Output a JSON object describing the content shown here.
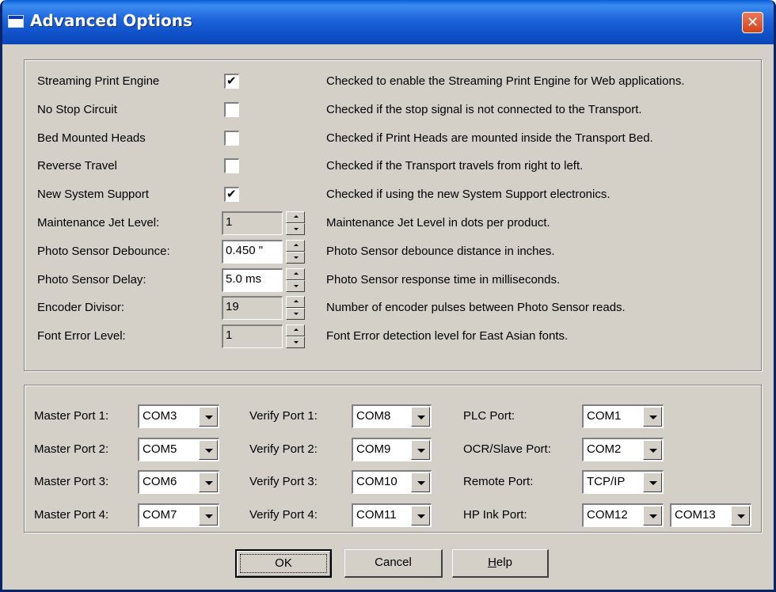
{
  "window": {
    "title": "Advanced Options",
    "close_glyph": "✕"
  },
  "options": [
    {
      "label": "Streaming Print Engine",
      "type": "checkbox",
      "checked": true,
      "description": "Checked to enable the Streaming Print Engine for Web applications."
    },
    {
      "label": "No Stop Circuit",
      "type": "checkbox",
      "checked": false,
      "description": "Checked if the stop signal is not connected to the Transport."
    },
    {
      "label": "Bed Mounted Heads",
      "type": "checkbox",
      "checked": false,
      "description": "Checked if Print Heads are mounted inside the Transport Bed."
    },
    {
      "label": "Reverse Travel",
      "type": "checkbox",
      "checked": false,
      "description": "Checked if the Transport travels from right to left."
    },
    {
      "label": "New System Support",
      "type": "checkbox",
      "checked": true,
      "description": "Checked if using the new System Support electronics."
    },
    {
      "label": "Maintenance Jet Level:",
      "type": "spin",
      "value": "1",
      "enabled": false,
      "description": "Maintenance Jet Level in dots per product."
    },
    {
      "label": "Photo Sensor Debounce:",
      "type": "spin",
      "value": "0.450 \"",
      "enabled": true,
      "description": "Photo Sensor debounce distance in inches."
    },
    {
      "label": "Photo Sensor Delay:",
      "type": "spin",
      "value": "5.0 ms",
      "enabled": true,
      "description": "Photo Sensor response time in milliseconds."
    },
    {
      "label": "Encoder Divisor:",
      "type": "spin",
      "value": "19",
      "enabled": false,
      "description": "Number of encoder pulses between Photo Sensor reads."
    },
    {
      "label": "Font Error Level:",
      "type": "spin",
      "value": "1",
      "enabled": false,
      "description": "Font Error detection level for East Asian fonts."
    }
  ],
  "ports": {
    "master": [
      {
        "label": "Master Port 1:",
        "value": "COM3"
      },
      {
        "label": "Master Port 2:",
        "value": "COM5"
      },
      {
        "label": "Master Port 3:",
        "value": "COM6"
      },
      {
        "label": "Master Port 4:",
        "value": "COM7"
      }
    ],
    "verify": [
      {
        "label": "Verify Port 1:",
        "value": "COM8"
      },
      {
        "label": "Verify Port 2:",
        "value": "COM9"
      },
      {
        "label": "Verify Port 3:",
        "value": "COM10"
      },
      {
        "label": "Verify Port 4:",
        "value": "COM11"
      }
    ],
    "other": [
      {
        "label": "PLC Port:",
        "value": "COM1"
      },
      {
        "label": "OCR/Slave Port:",
        "value": "COM2"
      },
      {
        "label": "Remote Port:",
        "value": "TCP/IP"
      },
      {
        "label": "HP Ink Port:",
        "value": "COM12",
        "value2": "COM13"
      }
    ]
  },
  "buttons": {
    "ok": "OK",
    "cancel": "Cancel",
    "help_prefix": "H",
    "help_rest": "elp"
  },
  "colors": {
    "title_bar": "#0a5fd8",
    "dialog_face": "#d4d0c8",
    "close_button": "#d4431c"
  }
}
